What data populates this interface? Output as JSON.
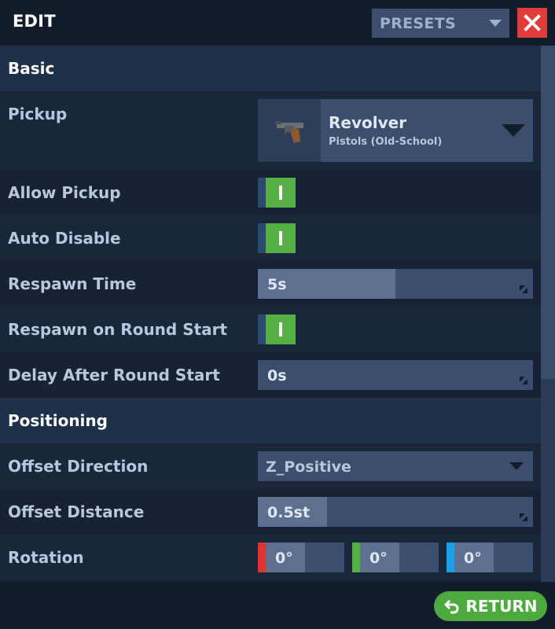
{
  "header": {
    "title": "EDIT",
    "presets_label": "PRESETS"
  },
  "sections": {
    "basic": "Basic",
    "positioning": "Positioning"
  },
  "pickup": {
    "label": "Pickup",
    "item_name": "Revolver",
    "item_category": "Pistols (Old-School)",
    "icon": "revolver-icon"
  },
  "allow_pickup": {
    "label": "Allow Pickup",
    "value": true
  },
  "auto_disable": {
    "label": "Auto Disable",
    "value": true
  },
  "respawn_time": {
    "label": "Respawn Time",
    "value": "5s"
  },
  "respawn_on_round_start": {
    "label": "Respawn on Round Start",
    "value": true
  },
  "delay_after_round_start": {
    "label": "Delay After Round Start",
    "value": "0s"
  },
  "offset_direction": {
    "label": "Offset Direction",
    "value": "Z_Positive"
  },
  "offset_distance": {
    "label": "Offset Distance",
    "value": "0.5st"
  },
  "rotation": {
    "label": "Rotation",
    "x": "0°",
    "y": "0°",
    "z": "0°",
    "x_color": "#e03232",
    "y_color": "#55b043",
    "z_color": "#1e9ee8"
  },
  "footer": {
    "return_label": "RETURN"
  },
  "colors": {
    "background": "#121c2b",
    "panel": "#172235",
    "section": "#1f3049",
    "control": "#3c4e6d",
    "toggle_on": "#55b043",
    "close": "#e33a3a",
    "return": "#4caa3e"
  }
}
